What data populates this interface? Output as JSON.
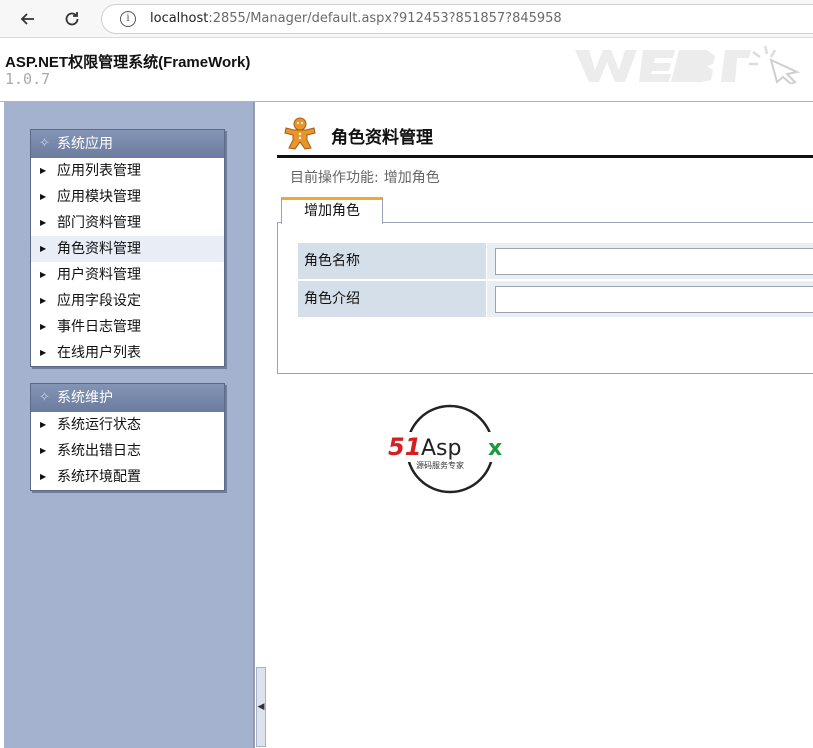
{
  "browser": {
    "url_host": "localhost",
    "url_rest": ":2855/Manager/default.aspx?912453?851857?845958"
  },
  "app": {
    "title": "ASP.NET权限管理系统(FrameWork)",
    "version": "1.0.7"
  },
  "sidebar": {
    "panels": [
      {
        "title": "系统应用",
        "items": [
          {
            "label": "应用列表管理"
          },
          {
            "label": "应用模块管理"
          },
          {
            "label": "部门资料管理"
          },
          {
            "label": "角色资料管理"
          },
          {
            "label": "用户资料管理"
          },
          {
            "label": "应用字段设定"
          },
          {
            "label": "事件日志管理"
          },
          {
            "label": "在线用户列表"
          }
        ]
      },
      {
        "title": "系统维护",
        "items": [
          {
            "label": "系统运行状态"
          },
          {
            "label": "系统出错日志"
          },
          {
            "label": "系统环境配置"
          }
        ]
      }
    ]
  },
  "main": {
    "page_title": "角色资料管理",
    "current_op_label": "目前操作功能:",
    "current_op_value": "增加角色",
    "tab_label": "增加角色",
    "form": {
      "fields": [
        {
          "label": "角色名称",
          "value": ""
        },
        {
          "label": "角色介绍",
          "value": ""
        }
      ]
    },
    "logo": {
      "brand": "51Aspx",
      "tagline": "源码服务专家"
    }
  },
  "colors": {
    "sidebar_bg": "#a4b2cf",
    "panel_head": "#7080a4",
    "tab_accent": "#f0a830",
    "label_bg": "#d5dfea",
    "logo_red": "#d42020",
    "logo_green": "#1a9a3a"
  }
}
